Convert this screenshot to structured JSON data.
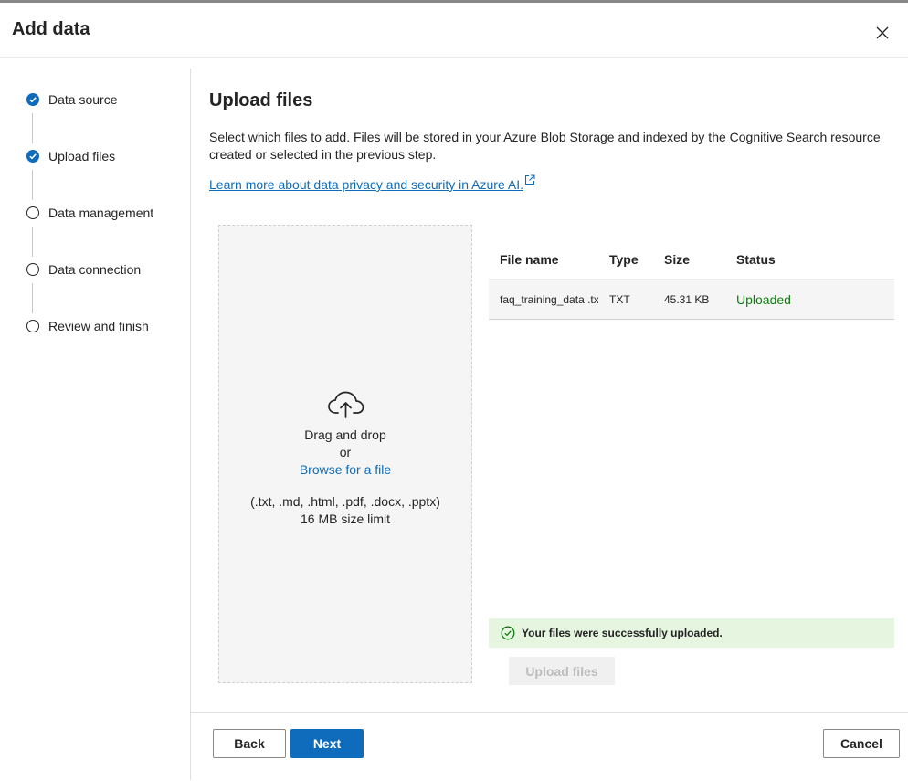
{
  "dialog": {
    "title": "Add data"
  },
  "steps": [
    {
      "label": "Data source",
      "state": "done"
    },
    {
      "label": "Upload files",
      "state": "done"
    },
    {
      "label": "Data management",
      "state": "todo"
    },
    {
      "label": "Data connection",
      "state": "todo"
    },
    {
      "label": "Review and finish",
      "state": "todo"
    }
  ],
  "main": {
    "title": "Upload files",
    "description": "Select which files to add. Files will be stored in your Azure Blob Storage and indexed by the Cognitive Search resource created or selected in the previous step.",
    "learn_link": "Learn more about data privacy and security in Azure AI."
  },
  "dropzone": {
    "line1": "Drag and drop",
    "line2": "or",
    "browse": "Browse for a file",
    "formats": "(.txt, .md, .html, .pdf, .docx, .pptx)",
    "limit": "16 MB size limit"
  },
  "table": {
    "headers": {
      "name": "File name",
      "type": "Type",
      "size": "Size",
      "status": "Status"
    },
    "rows": [
      {
        "name": "faq_training_data .txt",
        "type": "TXT",
        "size": "45.31 KB",
        "status": "Uploaded"
      }
    ]
  },
  "success_message": "Your files were successfully uploaded.",
  "upload_button": "Upload files",
  "footer": {
    "back": "Back",
    "next": "Next",
    "cancel": "Cancel"
  },
  "colors": {
    "accent": "#0f6cbd",
    "success": "#107c10",
    "success_bg": "#e5f5e0"
  }
}
